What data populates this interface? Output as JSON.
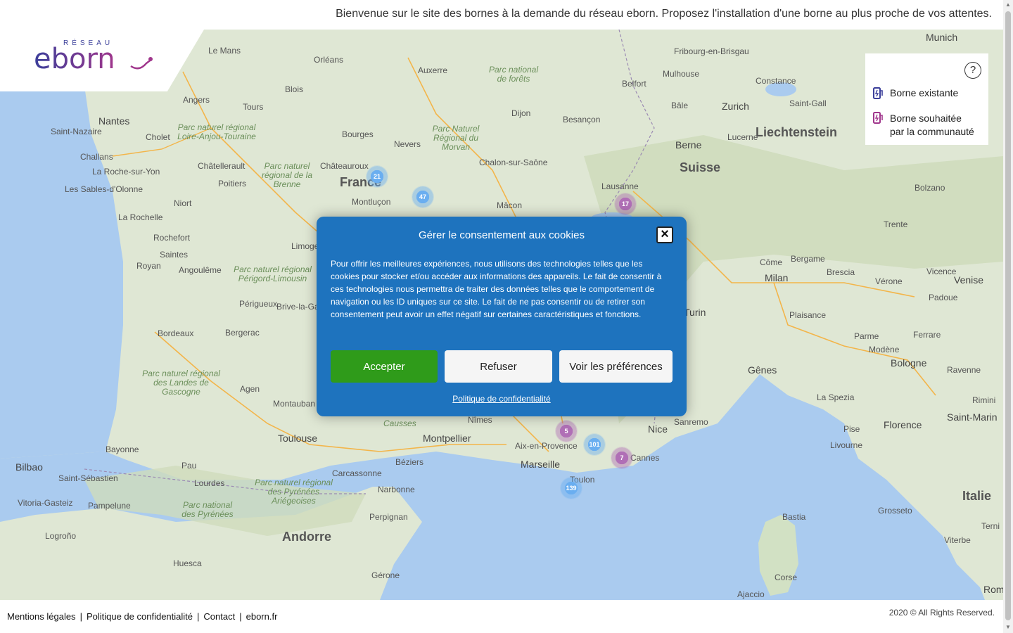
{
  "header": {
    "welcome_text": "Bienvenue sur le site des bornes à la demande du réseau eborn. Proposez l'installation d'une borne au plus proche de vos attentes."
  },
  "logo": {
    "brand": "eborn",
    "tagline": "RÉSEAU"
  },
  "legend": {
    "help_icon": "question-circle-icon",
    "items": [
      {
        "icon": "charging-station-icon",
        "color": "#3b3f9a",
        "label": "Borne existante"
      },
      {
        "icon": "charging-station-icon",
        "color": "#a0368c",
        "label_line1": "Borne souhaitée",
        "label_line2": "par la communauté"
      }
    ]
  },
  "map": {
    "cities": [
      "Le Mans",
      "Orléans",
      "Auxerre",
      "Parc national de forêts",
      "Fribourg-en-Brisgau",
      "Munich",
      "Mulhouse",
      "Constance",
      "Angers",
      "Tours",
      "Blois",
      "Dijon",
      "Belfort",
      "Bâle",
      "Zurich",
      "Saint-Gall",
      "Nantes",
      "Saint-Nazaire",
      "Cholet",
      "Bourges",
      "Nevers",
      "Besançon",
      "Liechtenstein",
      "Challans",
      "Châtellerault",
      "Châteauroux",
      "Chalon-sur-Saône",
      "Berne",
      "Lucerne",
      "La Roche-sur-Yon",
      "Poitiers",
      "France",
      "Suisse",
      "Bolzano",
      "Les Sables-d'Olonne",
      "Niort",
      "Montluçon",
      "Mâcon",
      "Lausanne",
      "La Rochelle",
      "Rochefort",
      "Limoges",
      "Trente",
      "Saintes",
      "Royan",
      "Angoulême",
      "Côme",
      "Bergame",
      "Milan",
      "Brescia",
      "Vérone",
      "Vicence",
      "Venise",
      "Padoue",
      "Périgueux",
      "Brive-la-Gaillarde",
      "Turin",
      "Plaisance",
      "Bordeaux",
      "Bergerac",
      "Parme",
      "Ferrare",
      "Modène",
      "Bologne",
      "Ravenne",
      "Gênes",
      "Agen",
      "Montauban",
      "La Spezia",
      "Rimini",
      "Toulouse",
      "Nîmes",
      "Montpellier",
      "Nice",
      "Sanremo",
      "Pise",
      "Florence",
      "Saint-Marin",
      "Aix-en-Provence",
      "Cannes",
      "Livourne",
      "Bayonne",
      "Bilbao",
      "Saint-Sébastien",
      "Pau",
      "Béziers",
      "Carcassonne",
      "Marseille",
      "Toulon",
      "Lourdes",
      "Narbonne",
      "Vitoria-Gasteiz",
      "Pampelune",
      "Perpignan",
      "Grosseto",
      "Bastia",
      "Italie",
      "Andorre",
      "Logroño",
      "Huesca",
      "Gérone",
      "Terni",
      "Viterbe",
      "Corse",
      "Ajaccio",
      "Rome"
    ],
    "parks": [
      "Parc naturel régional Loire-Anjou-Touraine",
      "Parc naturel régional de la Brenne",
      "Parc Naturel Régional du Morvan",
      "Parc naturel régional Périgord-Limousin",
      "Parc naturel régional des Landes de Gascogne",
      "Parc naturel régional des Pyrénées Ariégeoises",
      "Parc national des Pyrénées",
      "Causses"
    ],
    "clusters": [
      {
        "count": "21",
        "kind": "blue"
      },
      {
        "count": "47",
        "kind": "blue"
      },
      {
        "count": "17",
        "kind": "purple"
      },
      {
        "count": "5",
        "kind": "purple"
      },
      {
        "count": "101",
        "kind": "blue"
      },
      {
        "count": "7",
        "kind": "purple"
      },
      {
        "count": "139",
        "kind": "blue"
      }
    ]
  },
  "cookie_modal": {
    "title": "Gérer le consentement aux cookies",
    "body": "Pour offrir les meilleures expériences, nous utilisons des technologies telles que les cookies pour stocker et/ou accéder aux informations des appareils. Le fait de consentir à ces technologies nous permettra de traiter des données telles que le comportement de navigation ou les ID uniques sur ce site. Le fait de ne pas consentir ou de retirer son consentement peut avoir un effet négatif sur certaines caractéristiques et fonctions.",
    "accept_label": "Accepter",
    "refuse_label": "Refuser",
    "prefs_label": "Voir les préférences",
    "policy_label": "Politique de confidentialité",
    "close_icon": "close-icon",
    "accent_color": "#1e73be",
    "accept_color": "#2f9b1a"
  },
  "footer": {
    "links": [
      "Mentions légales",
      "Politique de confidentialité",
      "Contact",
      "eborn.fr"
    ],
    "copyright": "2020 © All Rights Reserved."
  }
}
